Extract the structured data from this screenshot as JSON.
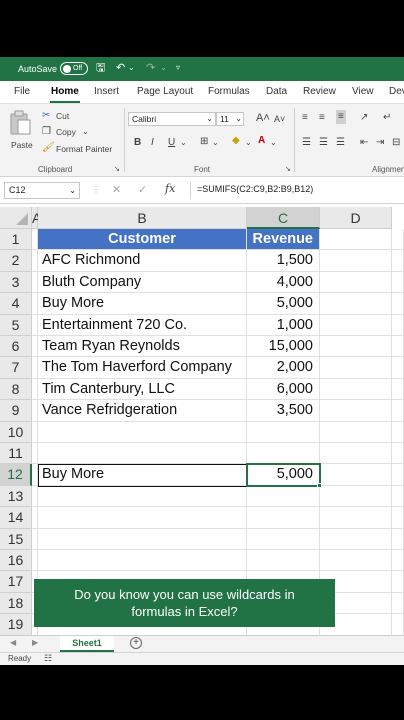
{
  "title_bar": {
    "autosave_label": "AutoSave",
    "autosave_state": "Off"
  },
  "ribbon_tabs": [
    "File",
    "Home",
    "Insert",
    "Page Layout",
    "Formulas",
    "Data",
    "Review",
    "View",
    "Dev"
  ],
  "clipboard": {
    "paste_label": "Paste",
    "cut_label": "Cut",
    "copy_label": "Copy",
    "format_painter_label": "Format Painter",
    "group_label": "Clipboard"
  },
  "font": {
    "name": "Calibri",
    "size": "11",
    "bold": "B",
    "italic": "I",
    "underline": "U",
    "group_label": "Font"
  },
  "alignment": {
    "group_label": "Alignmen"
  },
  "formula_bar": {
    "name_box": "C12",
    "fx": "fx",
    "formula": "=SUMIFS(C2:C9,B2:B9,B12)"
  },
  "columns": [
    "A",
    "B",
    "C",
    "D"
  ],
  "rows": [
    "1",
    "2",
    "3",
    "4",
    "5",
    "6",
    "7",
    "8",
    "9",
    "10",
    "11",
    "12",
    "13",
    "14",
    "15",
    "16",
    "17",
    "18",
    "19"
  ],
  "table": {
    "header": {
      "customer": "Customer",
      "revenue": "Revenue"
    },
    "rows": [
      {
        "customer": "AFC Richmond",
        "revenue": "1,500"
      },
      {
        "customer": "Bluth Company",
        "revenue": "4,000"
      },
      {
        "customer": "Buy More",
        "revenue": "5,000"
      },
      {
        "customer": "Entertainment 720 Co.",
        "revenue": "1,000"
      },
      {
        "customer": "Team Ryan Reynolds",
        "revenue": "15,000"
      },
      {
        "customer": "The Tom Haverford Company",
        "revenue": "2,000"
      },
      {
        "customer": "Tim Canterbury, LLC",
        "revenue": "6,000"
      },
      {
        "customer": "Vance Refridgeration",
        "revenue": "3,500"
      }
    ]
  },
  "lookup": {
    "criteria": "Buy More",
    "result": "5,000"
  },
  "callout": {
    "line1": "Do you know you can use wildcards in",
    "line2": "formulas in Excel?"
  },
  "sheet_tabs": [
    "Sheet1"
  ],
  "status": {
    "ready": "Ready"
  },
  "colors": {
    "excel_green": "#217346",
    "table_header_blue": "#4472c4"
  }
}
